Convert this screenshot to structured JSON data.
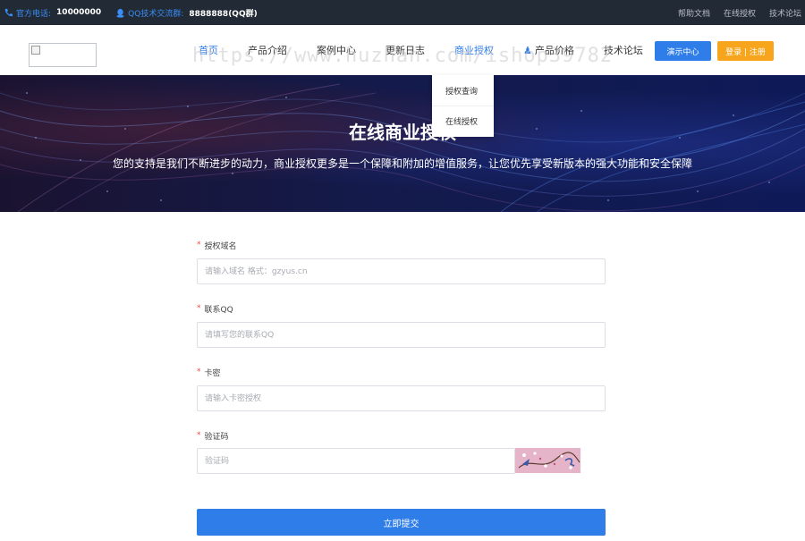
{
  "topbar": {
    "phone_label": "官方电话:",
    "phone_value": "10000000",
    "qq_label": "QQ技术交流群:",
    "qq_value": "8888888(QQ群)",
    "links": [
      "帮助文档",
      "在线授权",
      "技术论坛"
    ]
  },
  "header": {
    "nav": [
      "首页",
      "产品介绍",
      "案例中心",
      "更新日志",
      "商业授权",
      "产品价格",
      "技术论坛"
    ],
    "demo_button": "演示中心",
    "login_button": "登录 | 注册"
  },
  "watermark": "https://www.huzhan.com/ishop39782",
  "dropdown": [
    "授权查询",
    "在线授权"
  ],
  "hero": {
    "title": "在线商业授权",
    "subtitle": "您的支持是我们不断进步的动力，商业授权更多是一个保障和附加的增值服务，让您优先享受新版本的强大功能和安全保障"
  },
  "form": {
    "required_mark": "*",
    "domain_label": "授权域名",
    "domain_placeholder": "请输入域名 格式：gzyus.cn",
    "qq_label": "联系QQ",
    "qq_placeholder": "请填写您的联系QQ",
    "card_label": "卡密",
    "card_placeholder": "请输入卡密授权",
    "captcha_label": "验证码",
    "captcha_placeholder": "验证码",
    "submit_label": "立即提交"
  },
  "colors": {
    "accent": "#2f7de9",
    "login": "#f7a51c",
    "topbar": "#222a35",
    "required": "#f04b4b"
  }
}
